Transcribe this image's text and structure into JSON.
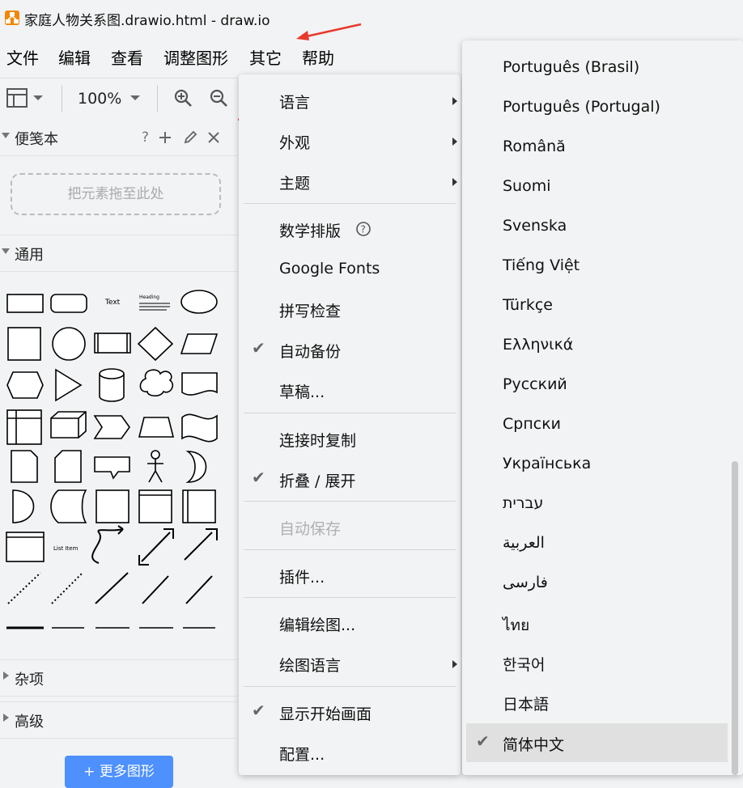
{
  "window": {
    "title": "家庭人物关系图.drawio.html - draw.io",
    "logo": "drawio-logo-icon"
  },
  "menubar": {
    "items": [
      "文件",
      "编辑",
      "查看",
      "调整图形",
      "其它",
      "帮助"
    ]
  },
  "toolbar": {
    "zoom": "100%",
    "icons": [
      "format-panel-icon",
      "zoom-in-icon",
      "zoom-out-icon"
    ]
  },
  "sidebar": {
    "scratchpad": {
      "title": "便笺本",
      "help": "?",
      "drop_hint": "把元素拖至此处"
    },
    "general": {
      "title": "通用",
      "shape_text": "Text",
      "heading_text": "Heading",
      "list_item_text": "List Item"
    },
    "misc": {
      "title": "杂项"
    },
    "advanced": {
      "title": "高级"
    },
    "more_shapes": "+ 更多图形"
  },
  "extras_menu": {
    "items": [
      {
        "label": "语言",
        "submenu": true,
        "checked": false
      },
      {
        "label": "外观",
        "submenu": true,
        "checked": false
      },
      {
        "label": "主题",
        "submenu": true,
        "checked": false
      },
      {
        "label": "数学排版",
        "help": true,
        "checked": false
      },
      {
        "label": "Google Fonts",
        "checked": false
      },
      {
        "label": "拼写检查",
        "checked": false
      },
      {
        "label": "自动备份",
        "checked": true
      },
      {
        "label": "草稿...",
        "checked": false
      },
      {
        "label": "连接时复制",
        "checked": false
      },
      {
        "label": "折叠 / 展开",
        "checked": true
      },
      {
        "label": "自动保存",
        "disabled": true,
        "checked": false
      },
      {
        "label": "插件...",
        "checked": false
      },
      {
        "label": "编辑绘图...",
        "checked": false
      },
      {
        "label": "绘图语言",
        "submenu": true,
        "checked": false
      },
      {
        "label": "显示开始画面",
        "checked": true
      },
      {
        "label": "配置...",
        "checked": false
      }
    ]
  },
  "language_menu": {
    "items": [
      "Português (Brasil)",
      "Português (Portugal)",
      "Română",
      "Suomi",
      "Svenska",
      "Tiếng Việt",
      "Türkçe",
      "Ελληνικά",
      "Русский",
      "Српски",
      "Українська",
      "עברית",
      "العربية",
      "فارسی",
      "ไทย",
      "한국어",
      "日本語",
      "简体中文"
    ],
    "selected": "简体中文"
  },
  "colors": {
    "accent": "#4d90fe",
    "arrow": "#e8392c",
    "logo": "#f08705"
  }
}
